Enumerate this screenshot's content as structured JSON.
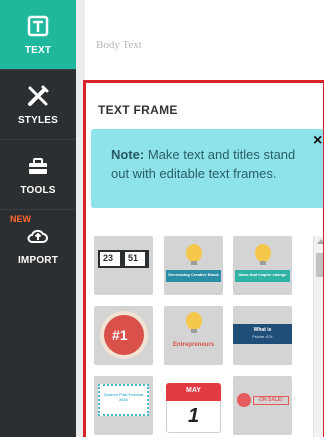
{
  "sidebar": {
    "items": [
      {
        "label": "TEXT",
        "icon": "text-frame-icon"
      },
      {
        "label": "STYLES",
        "icon": "brush-pencil-icon"
      },
      {
        "label": "TOOLS",
        "icon": "toolbox-icon"
      },
      {
        "label": "IMPORT",
        "icon": "cloud-upload-icon",
        "badge": "NEW"
      }
    ],
    "active_color": "#1fb89d",
    "badge_color": "#ff6a2a"
  },
  "header": {
    "body_text_label": "Body Text"
  },
  "panel": {
    "title": "TEXT FRAME",
    "note_label": "Note:",
    "note_text": "Make text and titles stand out with editable text frames.",
    "close_symbol": "×",
    "frame_color": "#d8232a",
    "note_color": "#8ee3ea"
  },
  "thumbnails": [
    {
      "name": "countdown-thumb",
      "text_a": "23",
      "text_b": "51"
    },
    {
      "name": "bulb-banner-thumb",
      "text": "Decreasing Creative Block"
    },
    {
      "name": "bulb-banner-thumb-2",
      "text": "Ideas that inspire change"
    },
    {
      "name": "badge-number-thumb",
      "text": "#1"
    },
    {
      "name": "entrepreneurs-thumb",
      "text": "Entrepreneurs"
    },
    {
      "name": "ribbon-thumb",
      "text": "What is",
      "text2": "Psiche d'Or"
    },
    {
      "name": "festival-thumb",
      "text": "Cannes Film Festival 2016"
    },
    {
      "name": "calendar-thumb",
      "month": "MAY",
      "day": "1"
    },
    {
      "name": "sale-thumb",
      "text": "ON SALE!"
    }
  ]
}
